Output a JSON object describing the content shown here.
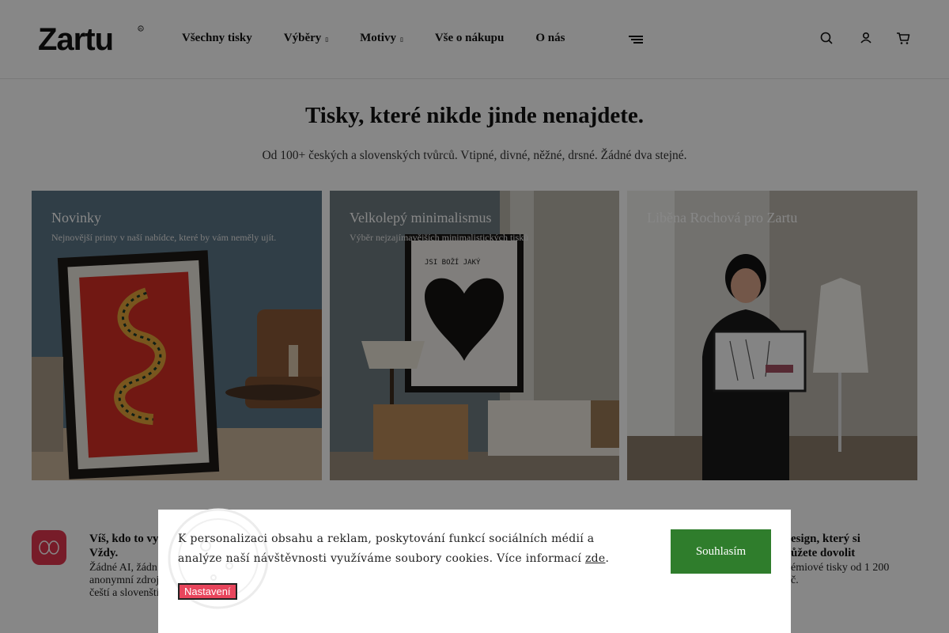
{
  "header": {
    "logo_text": "Zartu",
    "nav": [
      {
        "label": "Všechny tisky"
      },
      {
        "label": "Výběry"
      },
      {
        "label": "Motivy"
      },
      {
        "label": "Vše o nákupu"
      },
      {
        "label": "O nás"
      }
    ]
  },
  "hero": {
    "title": "Tisky, které nikde jinde nenajdete.",
    "subtitle": "Od 100+ českých a slovenských tvůrců. Vtipné, divné, něžné, drsné. Žádné dva stejné."
  },
  "cards": [
    {
      "title": "Novinky",
      "desc": "Nejnovější printy v naší nabídce, které by vám neměly ujít."
    },
    {
      "title": "Velkolepý minimalismus",
      "desc": "Výběr nejzajímavějších minimalistických tisků"
    },
    {
      "title": "Liběna Rochová pro Zartu",
      "desc": ""
    }
  ],
  "features": {
    "left_title_1": "Víš, kdo to vy",
    "left_title_2": "Vždy.",
    "left_text_1": "Žádné AI, žádn",
    "left_text_2": "anonymní zdroj",
    "left_text_3": "čeští a slovenští",
    "right_title_1": "esign, který si",
    "right_title_2": "ůžete dovolit",
    "right_text_1": "émiové tisky od 1 200",
    "right_text_2": "č."
  },
  "cookie": {
    "text": "K personalizaci obsahu a reklam, poskytování funkcí sociálních médií a analýze naší návštěvnosti využíváme soubory cookies. Více informací",
    "link": "zde",
    "accept": "Souhlasím",
    "settings": "Nastavení"
  },
  "colors": {
    "accept_green": "#2f7d2c",
    "settings_red": "#e8455c",
    "feature_icon_red": "#e0364e"
  }
}
